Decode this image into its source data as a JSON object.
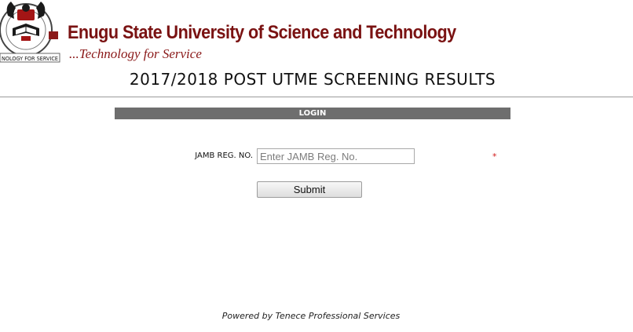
{
  "header": {
    "university_name": "Enugu State University of Science and Technology",
    "motto": "...Technology for Service",
    "logo_ring_text": "NOLOGY FOR SERVICE",
    "logo_icon": "university-crest-icon"
  },
  "page_title": "2017/2018 POST UTME SCREENING RESULTS",
  "login": {
    "section_title": "LOGIN",
    "jamb_label": "JAMB REG. NO.",
    "jamb_placeholder": "Enter JAMB Reg. No.",
    "jamb_value": "",
    "required_mark": "*",
    "submit_label": "Submit"
  },
  "footer": {
    "powered_by": "Powered by Tenece Professional Services"
  },
  "colors": {
    "brand": "#7a1212",
    "login_bar": "#6e6e6e",
    "required": "#d11a1a"
  }
}
